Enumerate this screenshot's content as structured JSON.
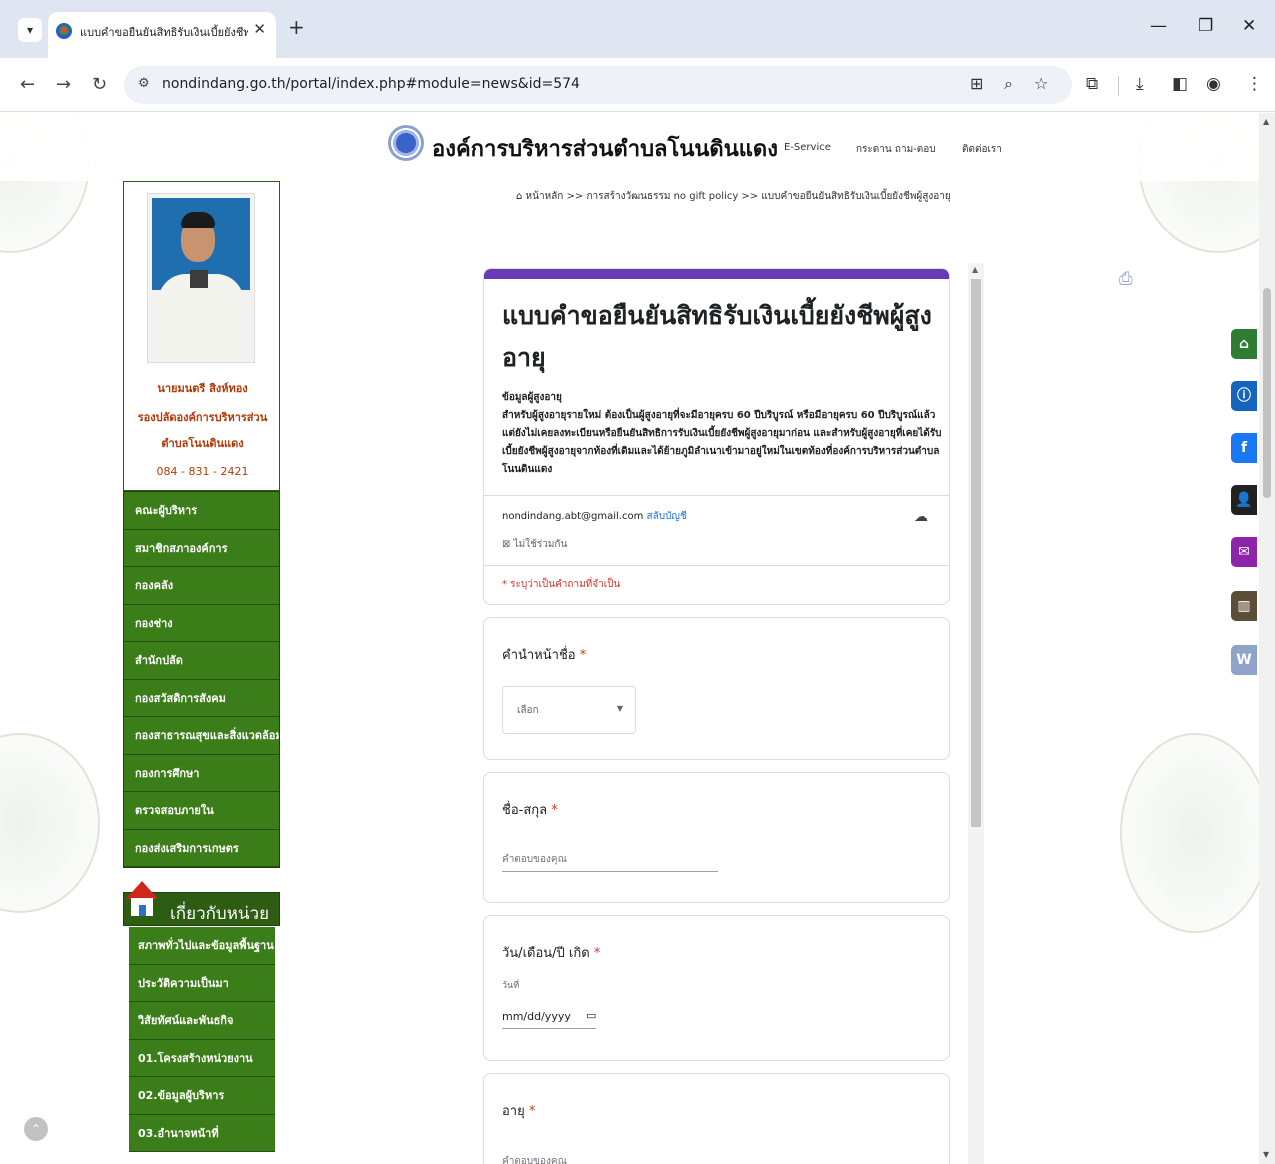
{
  "browser": {
    "tab_title": "แบบคำขอยืนยันสิทธิรับเงินเบี้ยยังชีพ",
    "url": "nondindang.go.th/portal/index.php#module=news&id=574",
    "icons": {
      "tab_list": "▾",
      "close_tab": "✕",
      "new_tab": "+",
      "minimize": "—",
      "restore": "❐",
      "close_window": "✕",
      "back": "←",
      "forward": "→",
      "reload": "↻",
      "site_info": "⚙",
      "translate": "⊞",
      "zoom": "⌕",
      "bookmark": "☆",
      "extensions": "⧉",
      "download": "⤓",
      "side_panel": "◧",
      "profile": "◉",
      "menu": "⋮"
    }
  },
  "site": {
    "title": "องค์การบริหารส่วนตำบลโนนดินแดง",
    "nav": [
      "E-Service",
      "กระดาน ถาม-ตอบ",
      "ติดต่อเรา"
    ]
  },
  "breadcrumb": {
    "home_icon": "⌂",
    "text": "หน้าหลัก >> การสร้างวัฒนธรรม no gift policy >> แบบคำขอยืนยันสิทธิรับเงินเบี้ยยังชีพผู้สูงอายุ"
  },
  "profile": {
    "name": "นายมนตรี สิงห์ทอง",
    "role": "รองปลัดองค์การบริหารส่วนตำบลโนนดินแดง",
    "phone": "084 - 831 - 2421"
  },
  "menu": [
    "คณะผู้บริหาร",
    "สมาชิกสภาองค์การ",
    "กองคลัง",
    "กองช่าง",
    "สำนักปลัด",
    "กองสวัสดิการสังคม",
    "กองสาธารณสุขและสิ่งแวดล้อม",
    "กองการศึกษา",
    "ตรวจสอบภายใน",
    "กองส่งเสริมการเกษตร"
  ],
  "about": {
    "title": "เกี่ยวกับหน่วย",
    "items": [
      "สภาพทั่วไปและข้อมูลพื้นฐาน",
      "ประวัติความเป็นมา",
      "วิสัยทัศน์และพันธกิจ",
      "01.โครงสร้างหน่วยงาน",
      "02.ข้อมูลผู้บริหาร",
      "03.อำนาจหน้าที่"
    ]
  },
  "form": {
    "title": "แบบคำขอยืนยันสิทธิรับเงินเบี้ยยังชีพผู้สูงอายุ",
    "desc_heading": "ข้อมูลผู้สูงอายุ",
    "desc_body": "สำหรับผู้สูงอายุรายใหม่ ต้องเป็นผู้สูงอายุที่จะมีอายุครบ 60 ปีบริบูรณ์ หรือมีอายุครบ 60 ปีบริบูรณ์แล้วแต่ยังไม่เคยลงทะเบียนหรือยืนยันสิทธิการรับเงินเบี้ยยังชีพผู้สูงอายุมาก่อน และสำหรับผู้สูงอายุที่เคยได้รับเบี้ยยังชีพผู้สูงอายุจากท้องที่เดิมและได้ย้ายภูมิลำเนาเข้ามาอยู่ใหม่ในเขตท้องที่องค์การบริหารส่วนตำบลโนนดินแดง",
    "account_email": "nondindang.abt@gmail.com",
    "switch_account": "สลับบัญชี",
    "not_shared": "ไม่ใช้ร่วมกัน",
    "required_note": "* ระบุว่าเป็นคำถามที่จำเป็น",
    "questions": [
      {
        "label": "คำนำหน้าชื่อ",
        "placeholder": "เลือก"
      },
      {
        "label": "ชื่อ-สกุล",
        "placeholder": "คำตอบของคุณ"
      },
      {
        "label": "วัน/เดือน/ปี เกิด",
        "sublabel": "วันที่",
        "value": "mm/dd/yyyy"
      },
      {
        "label": "อายุ",
        "placeholder": "คำตอบของคุณ"
      }
    ]
  },
  "colors": {
    "accent": "#673ab7",
    "sidebar_green": "#3b7d18",
    "required_red": "#d93025",
    "link_blue": "#1a73e8"
  },
  "floating_icons": [
    {
      "name": "home-icon",
      "glyph": "⌂",
      "color": "#2e7d32"
    },
    {
      "name": "info-icon",
      "glyph": "ⓘ",
      "color": "#1565c0"
    },
    {
      "name": "facebook-icon",
      "glyph": "f",
      "color": "#1877f2"
    },
    {
      "name": "user-icon",
      "glyph": "👤",
      "color": "#212121"
    },
    {
      "name": "mail-icon",
      "glyph": "✉",
      "color": "#8e24aa"
    },
    {
      "name": "chart-icon",
      "glyph": "▥",
      "color": "#5d4e37"
    },
    {
      "name": "word-icon",
      "glyph": "W",
      "color": "#8fa3c8"
    }
  ]
}
